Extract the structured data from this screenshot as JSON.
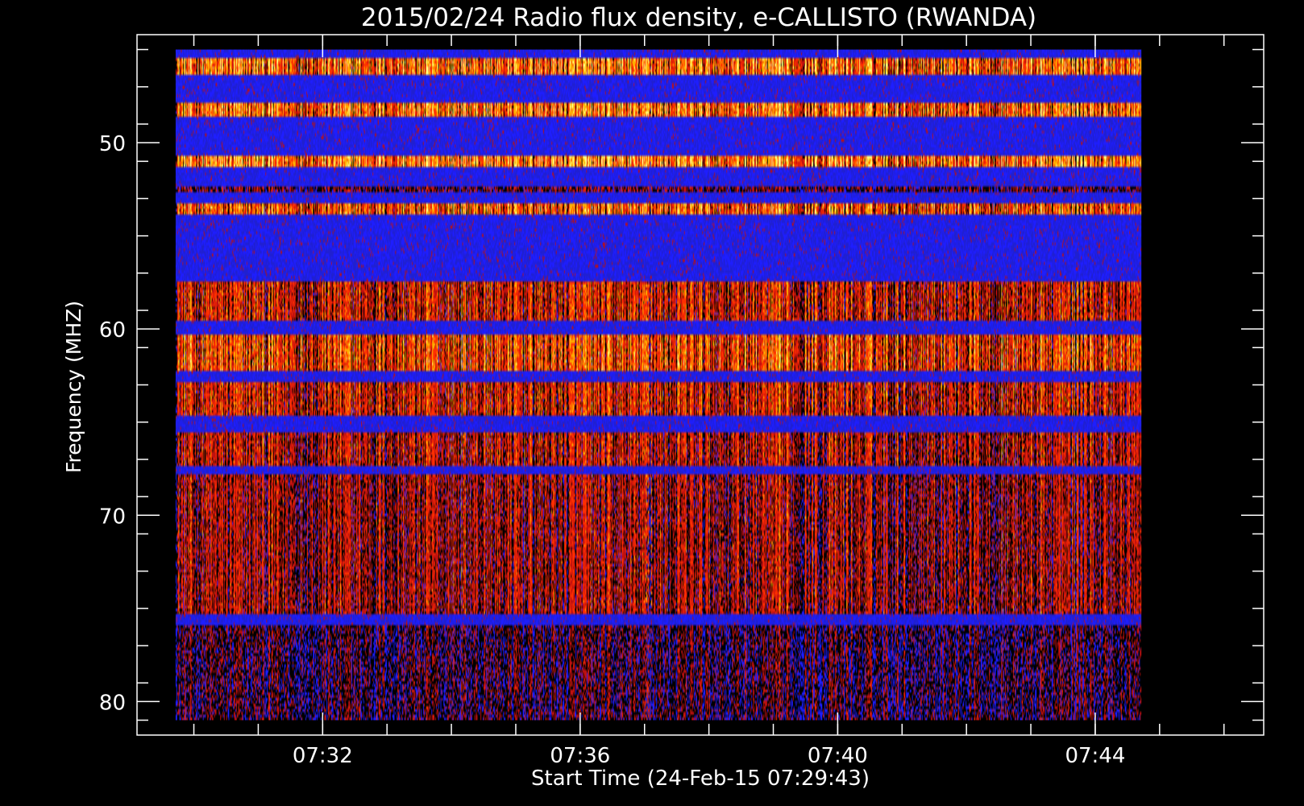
{
  "chart_data": {
    "type": "heatmap",
    "title": "2015/02/24  Radio flux density, e-CALLISTO (RWANDA)",
    "xlabel": "Start Time (24-Feb-15 07:29:43)",
    "ylabel": "Frequency (MHZ)",
    "x_ticks": [
      "07:32",
      "07:36",
      "07:40",
      "07:44"
    ],
    "x_tick_minutes": [
      2.283,
      6.283,
      10.283,
      14.283
    ],
    "x_minor_step_minutes": 1,
    "x_range_minutes": [
      -0.6,
      16.9
    ],
    "data_x_range_minutes": [
      0.0,
      15.0
    ],
    "y_ticks": [
      50,
      60,
      70,
      80
    ],
    "y_minor_step": 2,
    "ylim": [
      81.8,
      44.2
    ],
    "data_y_range": [
      45.0,
      81.0
    ],
    "y_axis_inverted": true,
    "colormap": [
      "#000000",
      "#2020d0",
      "#1e1eff",
      "#c01010",
      "#ff3000",
      "#ffb000",
      "#ffff80"
    ],
    "background_level": 1,
    "bright_bands_mhz": [
      {
        "from": 45.4,
        "to": 46.3,
        "level": 0.9
      },
      {
        "from": 47.9,
        "to": 48.6,
        "level": 0.9
      },
      {
        "from": 50.7,
        "to": 51.3,
        "level": 0.95
      },
      {
        "from": 52.3,
        "to": 52.7,
        "level": 0.5
      },
      {
        "from": 53.2,
        "to": 53.8,
        "level": 0.85
      },
      {
        "from": 57.4,
        "to": 59.6,
        "level": 0.7
      },
      {
        "from": 60.3,
        "to": 62.2,
        "level": 0.8
      },
      {
        "from": 62.9,
        "to": 64.6,
        "level": 0.7
      },
      {
        "from": 65.5,
        "to": 67.3,
        "level": 0.65
      },
      {
        "from": 67.8,
        "to": 75.3,
        "level": 0.6
      },
      {
        "from": 75.9,
        "to": 81.0,
        "level": 0.45
      }
    ],
    "burst_time_minutes": 7.35
  }
}
